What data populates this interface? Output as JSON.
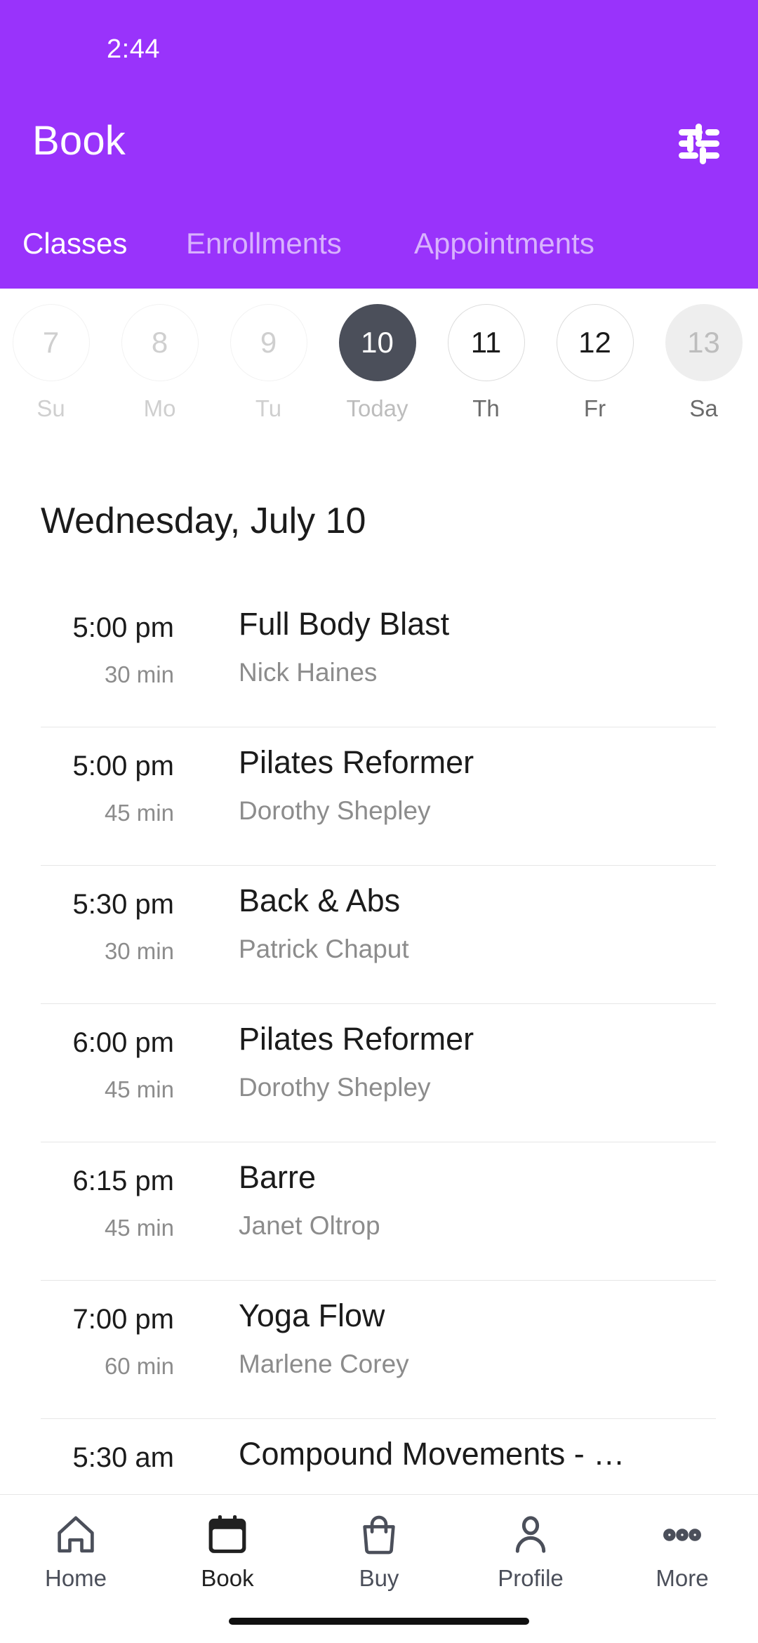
{
  "theme": {
    "brand_purple": "#9933fb",
    "today_circle": "#4b4f5a",
    "muted_text": "#8c8c8c",
    "divider": "#e6e6e6"
  },
  "status_bar": {
    "time": "2:44"
  },
  "header": {
    "title": "Book",
    "filter_icon": "tune-icon",
    "tabs": [
      {
        "label": "Classes",
        "active": true
      },
      {
        "label": "Enrollments",
        "active": false
      },
      {
        "label": "Appointments",
        "active": false
      }
    ]
  },
  "date_strip": {
    "days": [
      {
        "num": "7",
        "label": "Su",
        "state": "disabled"
      },
      {
        "num": "8",
        "label": "Mo",
        "state": "disabled"
      },
      {
        "num": "9",
        "label": "Tu",
        "state": "disabled"
      },
      {
        "num": "10",
        "label": "Today",
        "state": "today"
      },
      {
        "num": "11",
        "label": "Th",
        "state": "available"
      },
      {
        "num": "12",
        "label": "Fr",
        "state": "available"
      },
      {
        "num": "13",
        "label": "Sa",
        "state": "filled"
      }
    ]
  },
  "schedule": {
    "date_heading": "Wednesday, July 10",
    "classes": [
      {
        "time": "5:00 pm",
        "duration": "30 min",
        "name": "Full Body Blast",
        "staff": "Nick Haines"
      },
      {
        "time": "5:00 pm",
        "duration": "45 min",
        "name": "Pilates Reformer",
        "staff": "Dorothy Shepley"
      },
      {
        "time": "5:30 pm",
        "duration": "30 min",
        "name": "Back & Abs",
        "staff": "Patrick Chaput"
      },
      {
        "time": "6:00 pm",
        "duration": "45 min",
        "name": "Pilates Reformer",
        "staff": "Dorothy Shepley"
      },
      {
        "time": "6:15 pm",
        "duration": "45 min",
        "name": "Barre",
        "staff": "Janet Oltrop"
      },
      {
        "time": "7:00 pm",
        "duration": "60 min",
        "name": "Yoga Flow",
        "staff": "Marlene Corey"
      },
      {
        "time": "5:30 am",
        "duration": "",
        "name": "Compound Movements - …",
        "staff": ""
      }
    ]
  },
  "bottom_nav": {
    "items": [
      {
        "label": "Home",
        "icon": "home-icon",
        "active": false
      },
      {
        "label": "Book",
        "icon": "calendar-icon",
        "active": true
      },
      {
        "label": "Buy",
        "icon": "bag-icon",
        "active": false
      },
      {
        "label": "Profile",
        "icon": "person-icon",
        "active": false
      },
      {
        "label": "More",
        "icon": "dots-icon",
        "active": false
      }
    ]
  }
}
